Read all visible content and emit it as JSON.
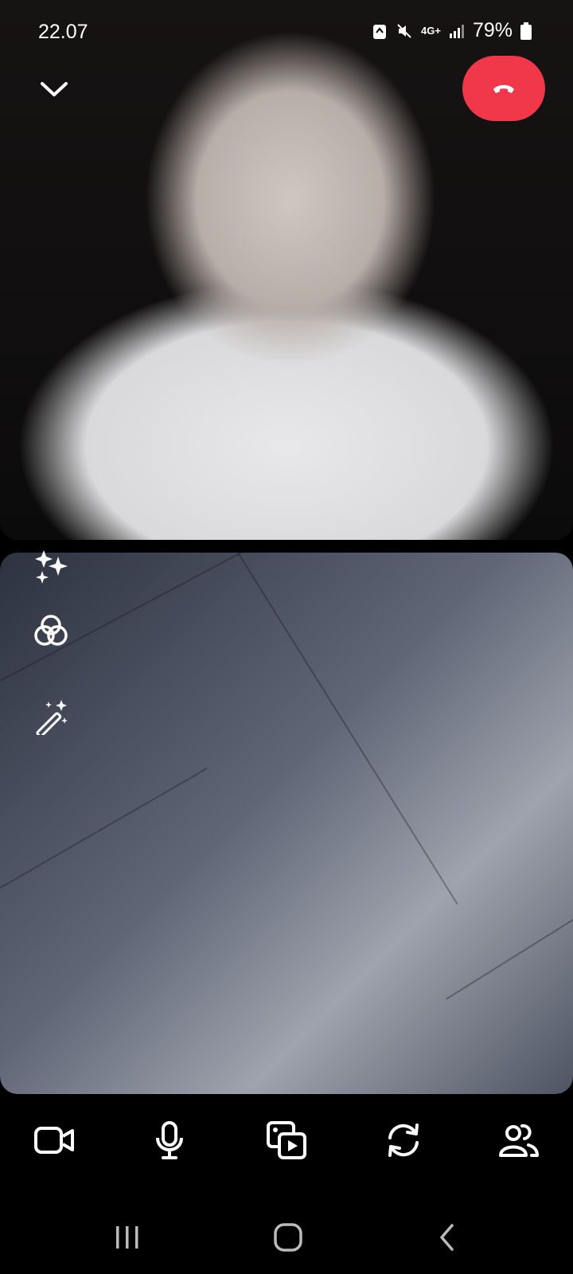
{
  "status_bar": {
    "time": "22.07",
    "network": "4G+",
    "battery": "79%"
  },
  "call": {
    "collapse_icon": "chevron-down-icon",
    "end_call_icon": "phone-hangup-icon",
    "end_call_color": "#f0384a"
  },
  "effects": [
    {
      "icon": "sparkles-icon"
    },
    {
      "icon": "filters-icon"
    },
    {
      "icon": "magic-wand-icon"
    }
  ],
  "controls": [
    {
      "icon": "video-camera-icon"
    },
    {
      "icon": "microphone-icon"
    },
    {
      "icon": "share-media-icon"
    },
    {
      "icon": "switch-camera-icon"
    },
    {
      "icon": "participants-icon"
    }
  ],
  "nav": [
    {
      "icon": "recents-icon"
    },
    {
      "icon": "home-icon"
    },
    {
      "icon": "back-icon"
    }
  ]
}
